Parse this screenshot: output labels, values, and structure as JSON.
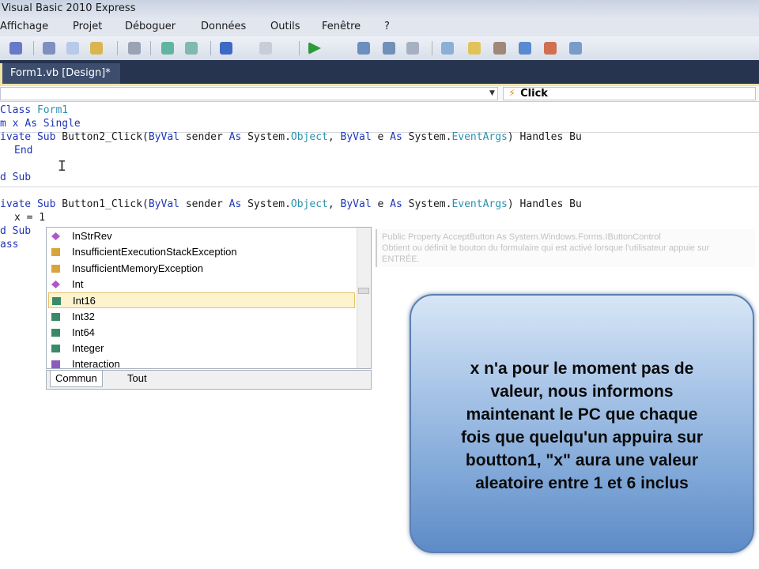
{
  "window": {
    "title": "Visual Basic 2010 Express"
  },
  "menu": [
    "Affichage",
    "Projet",
    "Déboguer",
    "Données",
    "Outils",
    "Fenêtre",
    "?"
  ],
  "tab": {
    "label": "Form1.vb [Design]*"
  },
  "navbar": {
    "right": "Click"
  },
  "code": {
    "l1": {
      "a": "Class",
      "b": "Form1"
    },
    "l2": {
      "a": "m x",
      "b": "As",
      "c": "Single"
    },
    "l3": {
      "a": "ivate",
      "b": "Sub",
      "c": " Button2_Click(",
      "d": "ByVal",
      "e": " sender ",
      "f": "As",
      "g": " System.",
      "h": "Object",
      "i": ", ",
      "j": "ByVal",
      "k": " e ",
      "l": "As",
      "m": " System.",
      "n": "EventArgs",
      "o": ") Handles Bu"
    },
    "l4": "End",
    "l5": {
      "a": "d",
      "b": "Sub"
    },
    "l6": {
      "c": " Button1_Click("
    },
    "l7": "x = 1",
    "l8": {
      "a": "d",
      "b": "Sub"
    },
    "l9": "ass"
  },
  "intellisense": {
    "items": [
      {
        "label": "InStrRev",
        "icon": "method-icon",
        "color": "#b257c9"
      },
      {
        "label": "InsufficientExecutionStackException",
        "icon": "class-icon",
        "color": "#d9a53b"
      },
      {
        "label": "InsufficientMemoryException",
        "icon": "class-icon",
        "color": "#d9a53b"
      },
      {
        "label": "Int",
        "icon": "method-icon",
        "color": "#b257c9"
      },
      {
        "label": "Int16",
        "icon": "structure-icon",
        "color": "#3a8a6a",
        "selected": true
      },
      {
        "label": "Int32",
        "icon": "structure-icon",
        "color": "#3a8a6a"
      },
      {
        "label": "Int64",
        "icon": "structure-icon",
        "color": "#3a8a6a"
      },
      {
        "label": "Integer",
        "icon": "structure-icon",
        "color": "#3a8a6a"
      },
      {
        "label": "Interaction",
        "icon": "module-icon",
        "color": "#8a5cc0"
      }
    ],
    "tabs": [
      "Commun",
      "Tout"
    ]
  },
  "tooltip": {
    "line1": "Public Property AcceptButton As System.Windows.Forms.IButtonControl",
    "line2": "Obtient ou définit le bouton du formulaire qui est activé lorsque l'utilisateur appuie sur",
    "line3": "ENTRÉE."
  },
  "callout": {
    "lines": [
      "x n'a pour le moment pas de",
      "valeur, nous informons",
      "maintenant le PC que chaque",
      "fois que quelqu'un appuira sur",
      "boutton1, \"x\" aura une valeur",
      "aleatoire entre 1 et 6 inclus"
    ]
  }
}
